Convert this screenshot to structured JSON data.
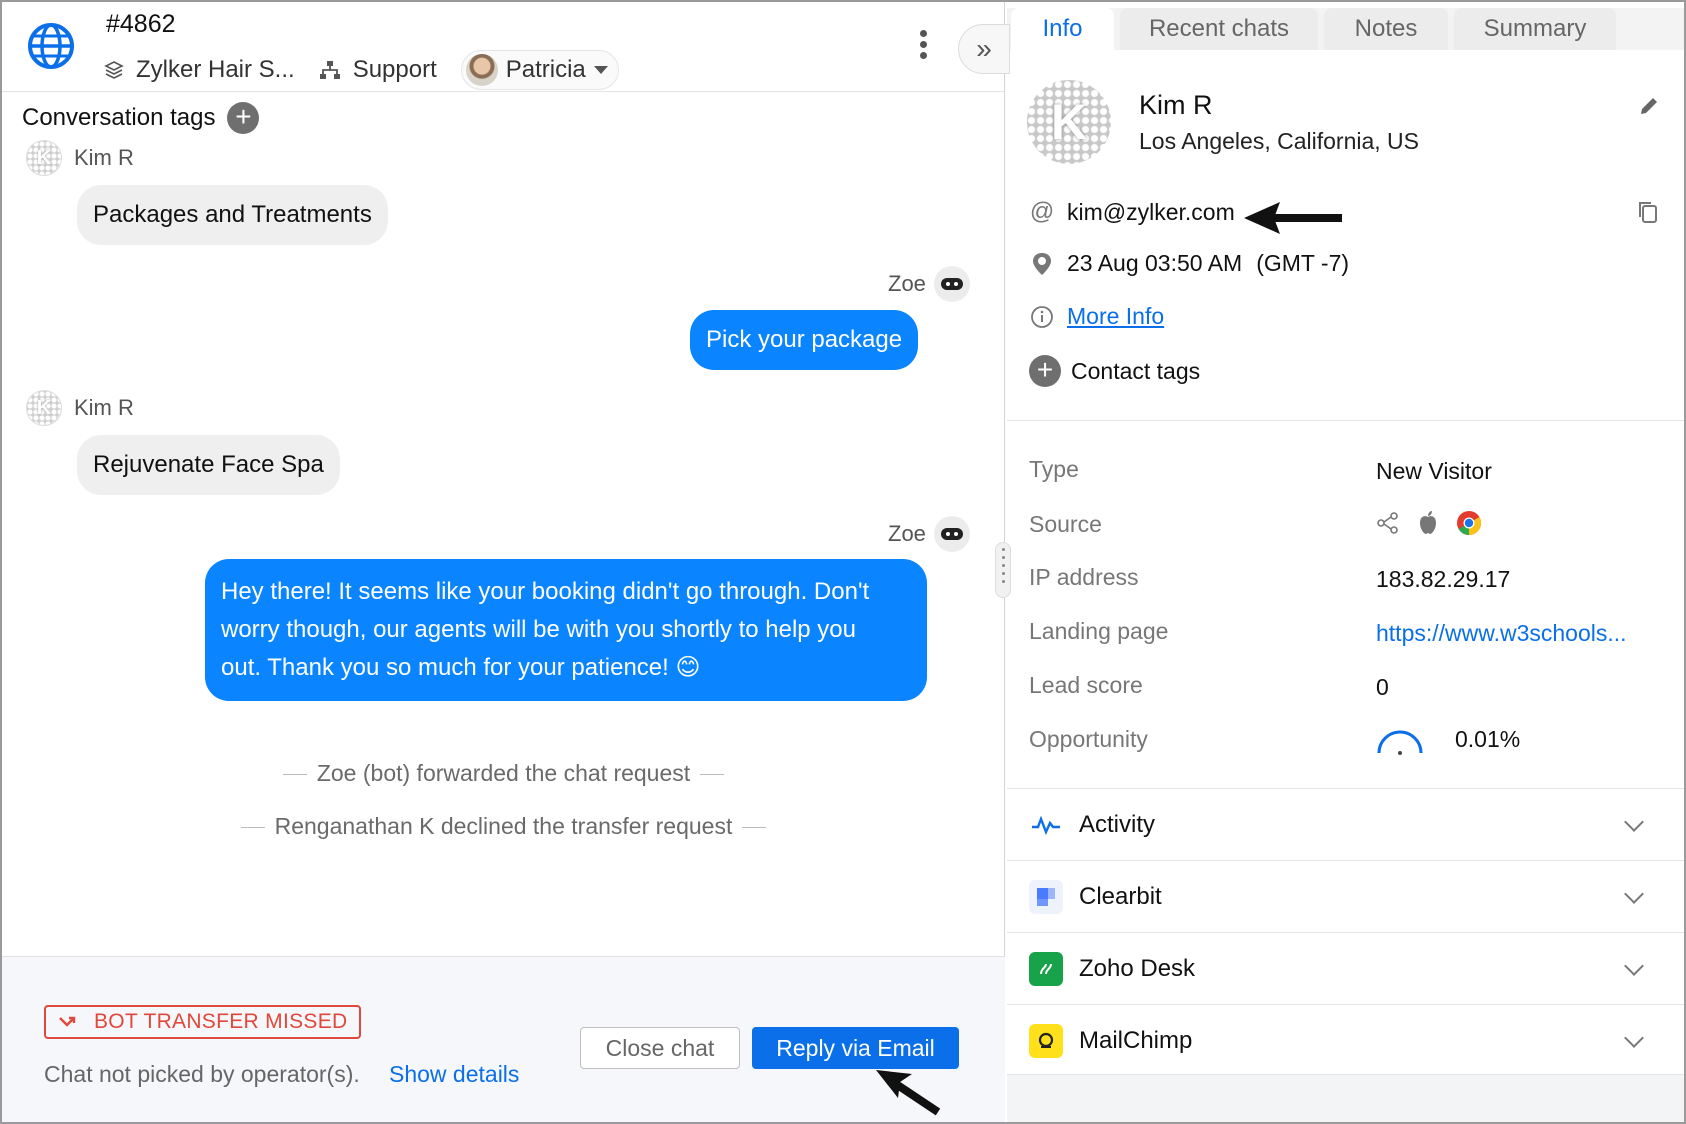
{
  "conversation": {
    "id": "#4862",
    "brand": "Zylker Hair S...",
    "department": "Support",
    "agent": "Patricia",
    "tags_label": "Conversation tags"
  },
  "messages": [
    {
      "author": "Kim R",
      "text": "Packages and Treatments"
    },
    {
      "author": "Zoe",
      "text": "Pick your package"
    },
    {
      "author": "Kim R",
      "text": "Rejuvenate Face Spa"
    },
    {
      "author": "Zoe",
      "lines": [
        "Hey there! It seems like your booking didn't go through. Don't",
        "worry though, our agents will be with you shortly to help you",
        "out. Thank you so much for your patience! 😊"
      ]
    }
  ],
  "system_events": [
    "Zoe (bot) forwarded the chat request",
    "Renganathan K declined the transfer request"
  ],
  "footer": {
    "status_badge": "BOT TRANSFER MISSED",
    "note": "Chat not picked by operator(s).",
    "show_details": "Show details",
    "close_label": "Close chat",
    "reply_label": "Reply via Email"
  },
  "tabs": [
    "Info",
    "Recent chats",
    "Notes",
    "Summary"
  ],
  "contact": {
    "avatar_letter": "K",
    "name": "Kim R",
    "location": "Los Angeles, California, US",
    "email": "kim@zylker.com",
    "time": "23 Aug 03:50 AM",
    "timezone": "(GMT -7)",
    "more_info": "More Info",
    "contact_tags": "Contact tags"
  },
  "details": {
    "type_label": "Type",
    "type_value": "New Visitor",
    "source_label": "Source",
    "ip_label": "IP address",
    "ip_value": "183.82.29.17",
    "landing_label": "Landing page",
    "landing_value": "https://www.w3schools...",
    "lead_label": "Lead score",
    "lead_value": "0",
    "opp_label": "Opportunity",
    "opp_value": "0.01%"
  },
  "integrations": [
    "Activity",
    "Clearbit",
    "Zoho Desk",
    "MailChimp"
  ],
  "colors": {
    "accent": "#0a84ff",
    "link": "#0a6fe8",
    "alert": "#e0483b"
  }
}
